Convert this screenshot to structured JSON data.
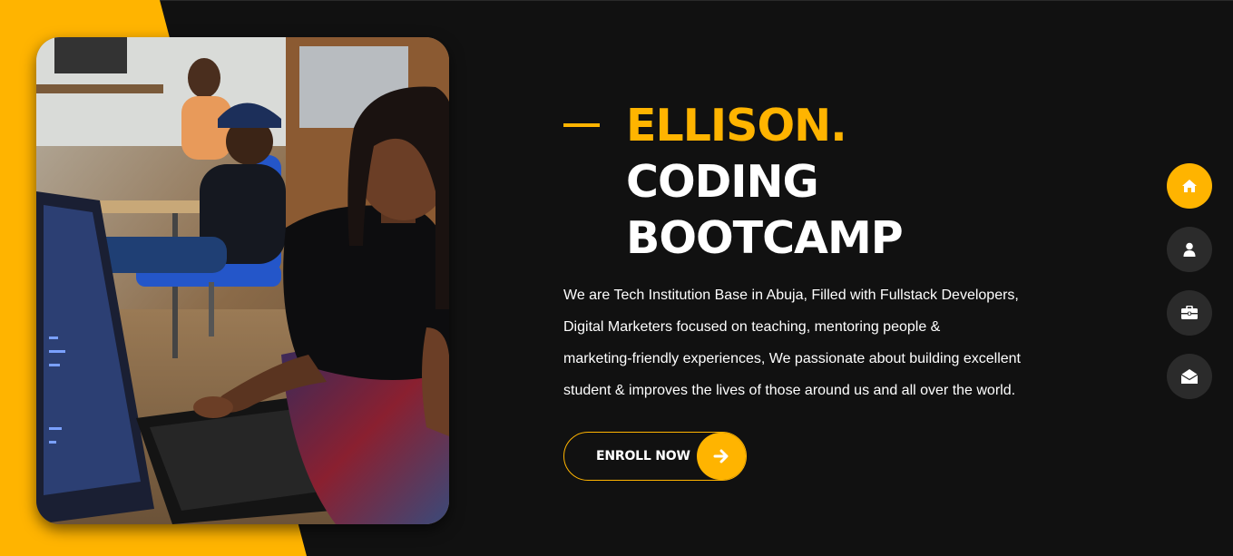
{
  "hero": {
    "title_highlight": "ELLISON.",
    "title_line2": "CODING",
    "title_line3": "BOOTCAMP",
    "description_lines": [
      "We are Tech Institution Base in Abuja, Filled with Fullstack Developers,",
      "Digital Marketers focused on teaching, mentoring people &",
      "marketing-friendly experiences, We passionate about building excellent",
      "student & improves the lives of those around us and all over the world."
    ],
    "cta_label": "ENROLL NOW",
    "cta_icon": "arrow-right-icon",
    "photo_icon": "students-coding-photo"
  },
  "side_nav": {
    "items": [
      {
        "icon": "home-icon",
        "active": true
      },
      {
        "icon": "user-icon",
        "active": false
      },
      {
        "icon": "briefcase-icon",
        "active": false
      },
      {
        "icon": "envelope-open-icon",
        "active": false
      }
    ]
  },
  "colors": {
    "accent": "#FFB400",
    "background": "#111111",
    "nav_inactive": "#2b2b2b",
    "text": "#FFFFFF"
  }
}
